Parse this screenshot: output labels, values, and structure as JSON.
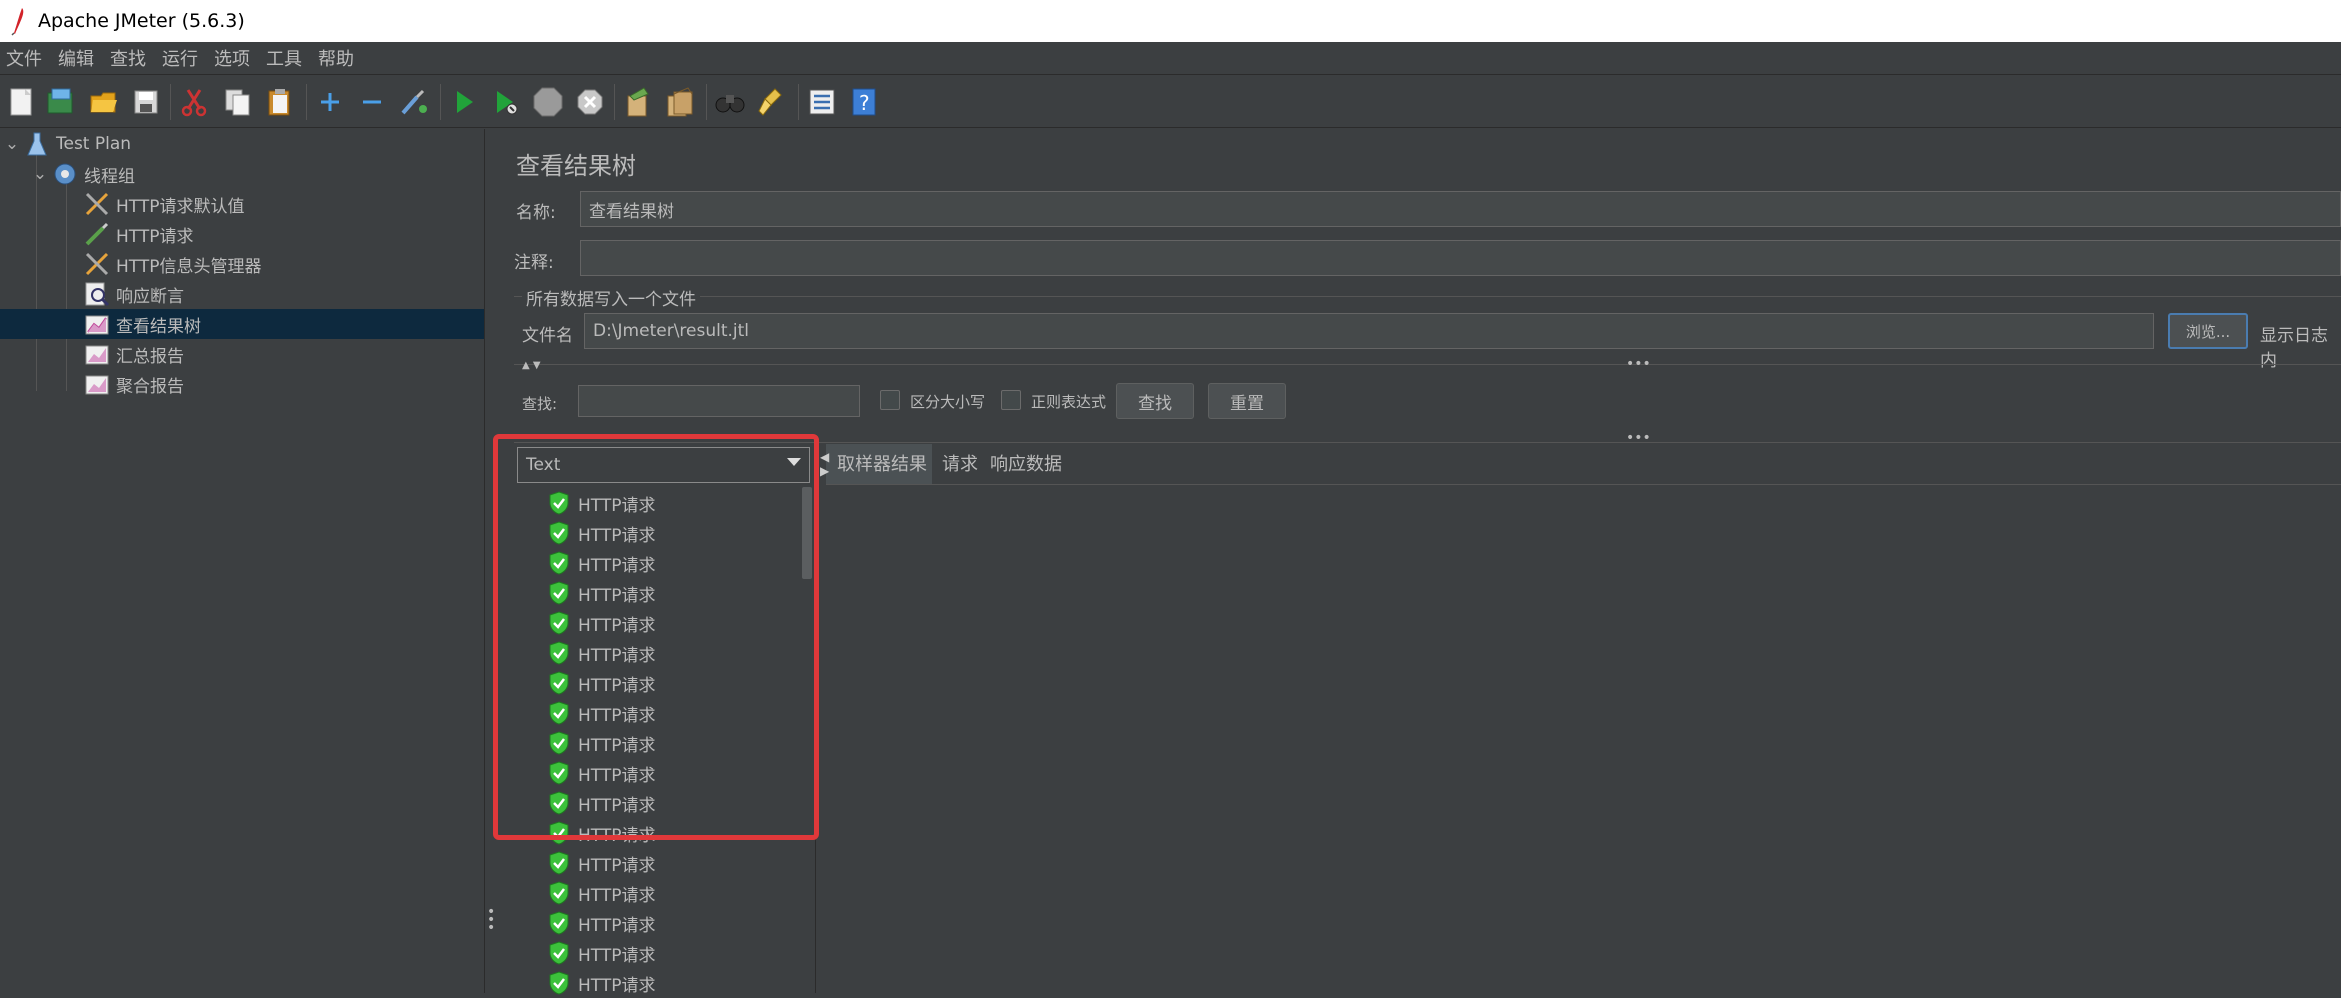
{
  "window": {
    "title": "Apache JMeter (5.6.3)"
  },
  "menu": [
    "文件",
    "编辑",
    "查找",
    "运行",
    "选项",
    "工具",
    "帮助"
  ],
  "toolbar": {
    "icons": [
      "new-icon",
      "templates-icon",
      "open-icon",
      "save-icon",
      "cut-icon",
      "copy-icon",
      "paste-icon",
      "expand-icon",
      "collapse-icon",
      "toggle-icon",
      "start-icon",
      "start-no-pauses-icon",
      "stop-icon",
      "shutdown-icon",
      "clear-icon",
      "clear-all-icon",
      "search-icon",
      "reset-search-icon",
      "function-helper-icon",
      "help-icon"
    ]
  },
  "tree": {
    "items": [
      {
        "label": "Test Plan",
        "icon": "flask-icon"
      },
      {
        "label": "线程组",
        "icon": "gear-icon"
      },
      {
        "label": "HTTP请求默认值",
        "icon": "tools-icon"
      },
      {
        "label": "HTTP请求",
        "icon": "pipette-icon"
      },
      {
        "label": "HTTP信息头管理器",
        "icon": "tools-icon"
      },
      {
        "label": "响应断言",
        "icon": "magnifier-icon"
      },
      {
        "label": "查看结果树",
        "icon": "graph-icon"
      },
      {
        "label": "汇总报告",
        "icon": "graph-icon"
      },
      {
        "label": "聚合报告",
        "icon": "graph-icon"
      }
    ]
  },
  "panel": {
    "title": "查看结果树",
    "name_label": "名称:",
    "name_value": "查看结果树",
    "comment_label": "注释:",
    "comment_value": "",
    "file_group_title": "所有数据写入一个文件",
    "file_label": "文件名",
    "file_value": "D:\\Jmeter\\result.jtl",
    "browse_button": "浏览...",
    "log_label": "显示日志内",
    "search_label": "查找:",
    "search_value": "",
    "case_sensitive_label": "区分大小写",
    "regex_label": "正则表达式",
    "find_button": "查找",
    "reset_button": "重置",
    "renderer_selected": "Text",
    "tabs": [
      "取样器结果",
      "请求",
      "响应数据"
    ],
    "results": [
      "HTTP请求",
      "HTTP请求",
      "HTTP请求",
      "HTTP请求",
      "HTTP请求",
      "HTTP请求",
      "HTTP请求",
      "HTTP请求",
      "HTTP请求",
      "HTTP请求",
      "HTTP请求",
      "HTTP请求",
      "HTTP请求",
      "HTTP请求",
      "HTTP请求",
      "HTTP请求",
      "HTTP请求"
    ]
  },
  "colors": {
    "highlight_box": "#e0383a",
    "success": "#3cc13b",
    "selection": "#0d293e"
  }
}
